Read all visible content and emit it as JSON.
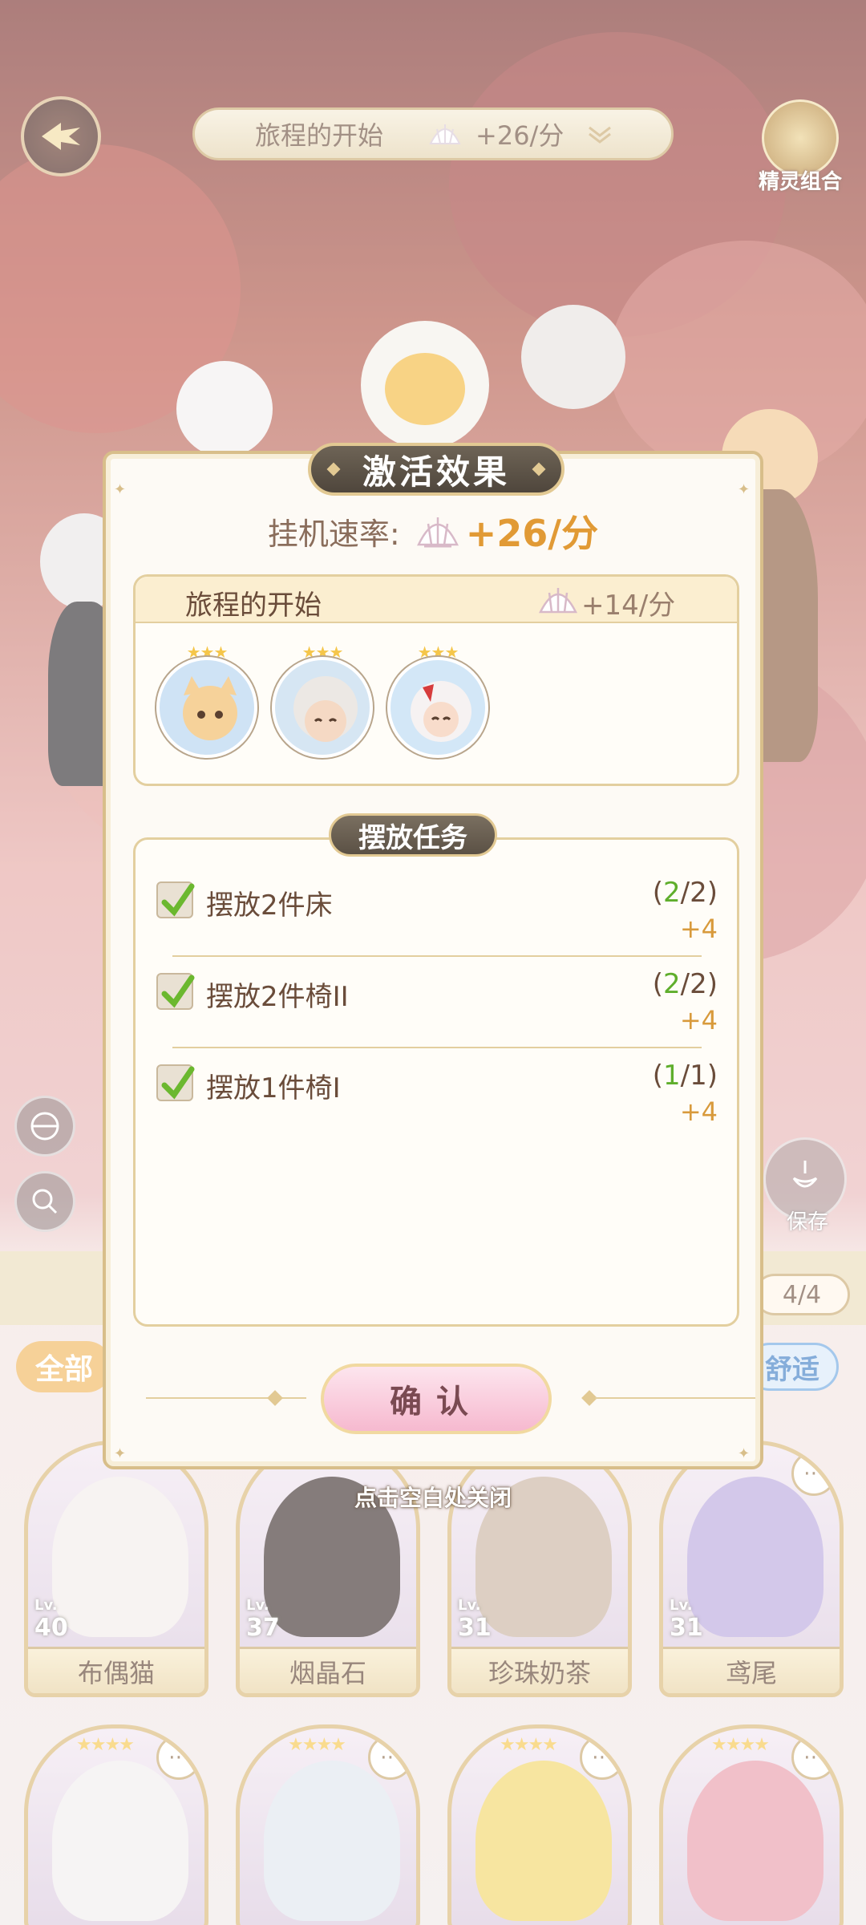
{
  "topbar": {
    "stage_name": "旅程的开始",
    "rate": "+26/分",
    "sprite_combo_label": "精灵组合"
  },
  "side": {
    "save_label": "保存"
  },
  "bottom": {
    "page_count": "4/4",
    "filter_all": "全部",
    "filter_comfort": "舒适",
    "cards": [
      {
        "name": "布偶猫",
        "lv_prefix": "Lv.",
        "level": "40"
      },
      {
        "name": "烟晶石",
        "lv_prefix": "Lv.",
        "level": "37"
      },
      {
        "name": "珍珠奶茶",
        "lv_prefix": "Lv.",
        "level": "31"
      },
      {
        "name": "鸢尾",
        "lv_prefix": "Lv.",
        "level": "31"
      }
    ]
  },
  "dialog": {
    "title": "激活效果",
    "rate_label": "挂机速率:",
    "rate_value": "+26/分",
    "combo": {
      "name": "旅程的开始",
      "rate": "+14/分"
    },
    "task_section_title": "摆放任务",
    "tasks": [
      {
        "label": "摆放2件床",
        "progress_open": "(",
        "done": "2",
        "total": "/2)",
        "reward": "+4"
      },
      {
        "label": "摆放2件椅II",
        "progress_open": "(",
        "done": "2",
        "total": "/2)",
        "reward": "+4"
      },
      {
        "label": "摆放1件椅I",
        "progress_open": "(",
        "done": "1",
        "total": "/1)",
        "reward": "+4"
      }
    ],
    "confirm_label": "确认"
  },
  "close_hint": "点击空白处关闭",
  "colors": {
    "accent_gold": "#d8be8a",
    "rate_orange": "#e19a35",
    "done_green": "#5fae2c",
    "confirm_pink": "#f6b9cf"
  }
}
